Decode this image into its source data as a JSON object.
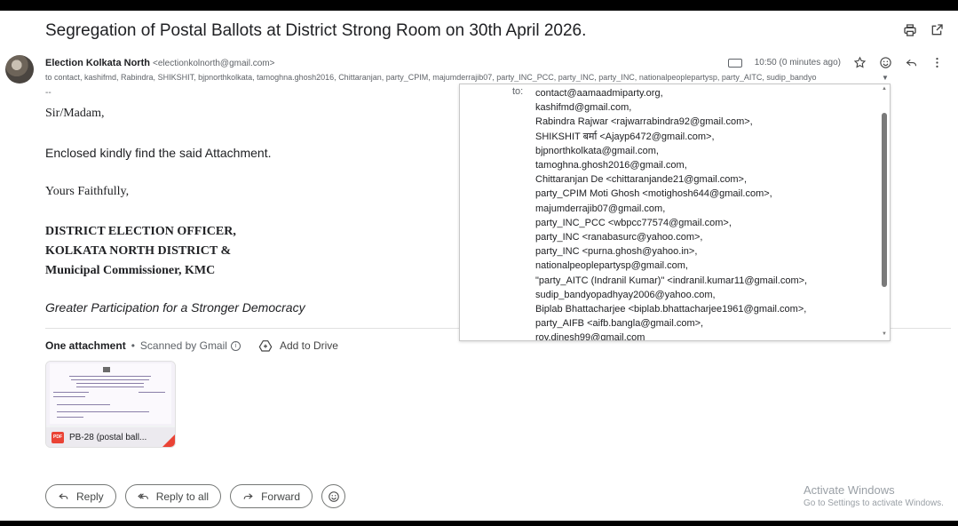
{
  "email": {
    "subject": "Segregation of Postal Ballots at District Strong Room on 30th April 2026.",
    "sender_name": "Election Kolkata North",
    "sender_email": "<electionkolnorth@gmail.com>",
    "recipients_line": "to contact, kashifmd, Rabindra, SHIKSHIT, bjpnorthkolkata, tamoghna.ghosh2016, Chittaranjan, party_CPIM, majumderrajib07, party_INC_PCC, party_INC, party_INC, nationalpeoplepartysp, party_AITC, sudip_bandyo",
    "time": "10:50 (0 minutes ago)",
    "separator": "--",
    "greeting": "Sir/Madam,",
    "line1": "Enclosed kindly find the said Attachment.",
    "closing": "Yours Faithfully,",
    "signature": {
      "line1": "DISTRICT ELECTION OFFICER,",
      "line2": "KOLKATA NORTH DISTRICT &",
      "line3": "Municipal Commissioner, KMC"
    },
    "tagline": "Greater Participation for a Stronger Democracy"
  },
  "attachments": {
    "title": "One attachment",
    "dot": "•",
    "scanned": "Scanned by Gmail",
    "add_to_drive": "Add to Drive",
    "file_name": "PB-28 (postal ball...",
    "file_type": "PDF"
  },
  "actions": {
    "reply": "Reply",
    "reply_all": "Reply to all",
    "forward": "Forward"
  },
  "recipients_popup": {
    "to_label": "to:",
    "items": [
      "contact@aamaadmiparty.org,",
      "kashifmd@gmail.com,",
      "Rabindra Rajwar <rajwarrabindra92@gmail.com>,",
      "SHIKSHIT बर्मा <Ajayp6472@gmail.com>,",
      "bjpnorthkolkata@gmail.com,",
      "tamoghna.ghosh2016@gmail.com,",
      "Chittaranjan De <chittaranjande21@gmail.com>,",
      "party_CPIM Moti Ghosh <motighosh644@gmail.com>,",
      "majumderrajib07@gmail.com,",
      "party_INC_PCC <wbpcc77574@gmail.com>,",
      "party_INC <ranabasurc@yahoo.com>,",
      "party_INC <purna.ghosh@yahoo.in>,",
      "nationalpeoplepartysp@gmail.com,",
      "\"party_AITC (Indranil Kumar)\" <indranil.kumar11@gmail.com>,",
      "sudip_bandyopadhyay2006@yahoo.com,",
      "Biplab Bhattacharjee <biplab.bhattacharjee1961@gmail.com>,",
      "party_AIFB <aifb.bangla@gmail.com>,",
      "roy.dinesh99@gmail.com"
    ]
  },
  "watermark": {
    "title": "Activate Windows",
    "subtitle": "Go to Settings to activate Windows."
  },
  "icons": {
    "print": "print-icon",
    "open_new": "open-in-new-icon",
    "label": "label-icon",
    "star": "star-icon",
    "emoji": "emoji-icon",
    "reply": "reply-icon",
    "more": "more-vert-icon"
  },
  "colors": {
    "pdf_red": "#ea4335",
    "text": "#202124",
    "muted": "#5f6368"
  }
}
